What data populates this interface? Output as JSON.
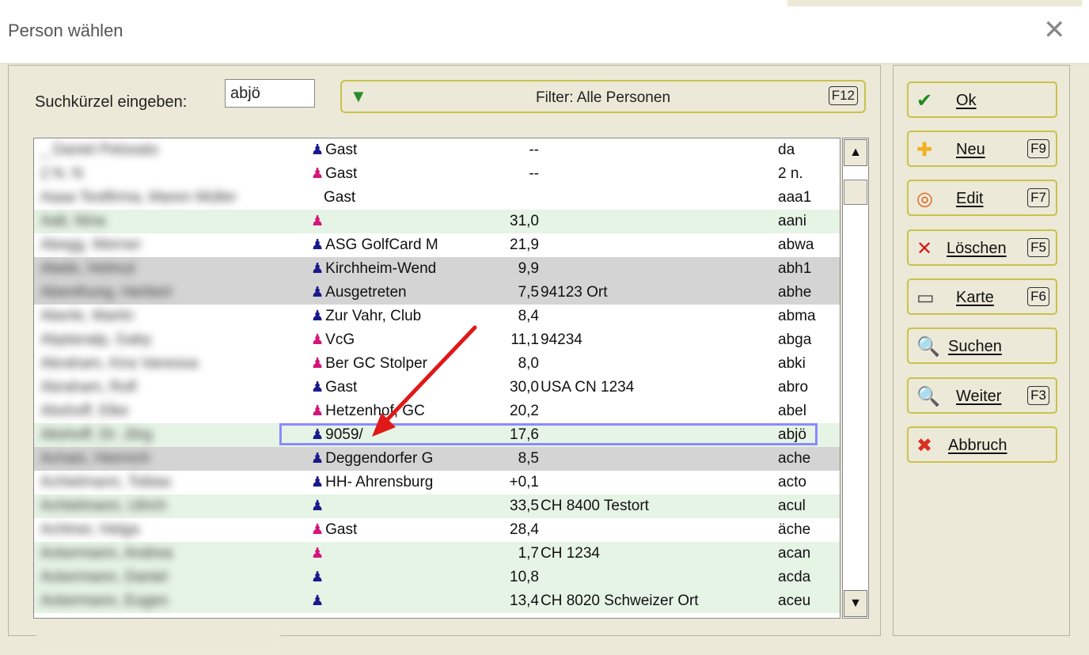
{
  "window": {
    "title": "Person wählen",
    "close_glyph": "✕"
  },
  "search": {
    "label": "Suchkürzel eingeben:",
    "value": "abjö"
  },
  "filter": {
    "label": "Filter: Alle Personen",
    "key": "F12",
    "icon": "filter-funnel-icon"
  },
  "colors": {
    "male": "#1a1a8c",
    "female": "#d6157a",
    "highlight": "#e6f4e6",
    "gray": "#d4d4d4",
    "selected_border": "#8a8aff",
    "button_border": "#c9c24a"
  },
  "rows": [
    {
      "blur": "_ Daniel Pelosato",
      "gender": "m",
      "club": "Gast",
      "hcp": "--",
      "place": "",
      "code": "da",
      "bg": "white"
    },
    {
      "blur": "2 N. N",
      "gender": "f",
      "club": "Gast",
      "hcp": "--",
      "place": "",
      "code": "2 n.",
      "bg": "white"
    },
    {
      "blur": "Aaaa Testfirma, Maren Müller",
      "gender": "",
      "club": "Gast",
      "hcp": "",
      "place": "",
      "code": "aaa1",
      "bg": "white"
    },
    {
      "blur": "Aalt, Nina",
      "gender": "f",
      "club": "",
      "hcp": "31,0",
      "place": "",
      "code": "aani",
      "bg": "green"
    },
    {
      "blur": "Abegg, Werner",
      "gender": "m",
      "club": "ASG GolfCard M",
      "hcp": "21,9",
      "place": "",
      "code": "abwa",
      "bg": "white"
    },
    {
      "blur": "Abele, Helmut",
      "gender": "m",
      "club": "Kirchheim-Wend",
      "hcp": "9,9",
      "place": "",
      "code": "abh1",
      "bg": "gray"
    },
    {
      "blur": "Abenthung, Herbert",
      "gender": "m",
      "club": "Ausgetreten",
      "hcp": "7,5",
      "place": "94123 Ort",
      "code": "abhe",
      "bg": "gray"
    },
    {
      "blur": "Aberle, Martin",
      "gender": "m",
      "club": "Zur Vahr, Club",
      "hcp": "8,4",
      "place": "",
      "code": "abma",
      "bg": "white"
    },
    {
      "blur": "Abplanalp, Gaby",
      "gender": "f",
      "club": "VcG",
      "hcp": "11,1",
      "place": "94234",
      "code": "abga",
      "bg": "white"
    },
    {
      "blur": "Abraham, Kira Vanessa",
      "gender": "f",
      "club": "Ber GC Stolper",
      "hcp": "8,0",
      "place": "",
      "code": "abki",
      "bg": "white"
    },
    {
      "blur": "Abraham, Rolf",
      "gender": "m",
      "club": "Gast",
      "hcp": "30,0",
      "place": "USA CN 1234",
      "code": "abro",
      "bg": "white"
    },
    {
      "blur": "Abshoff, Elke",
      "gender": "f",
      "club": "Hetzenhof, GC",
      "hcp": "20,2",
      "place": "",
      "code": "abel",
      "bg": "white"
    },
    {
      "blur": "Abshoff, Dr. Jörg",
      "gender": "m",
      "club": "9059/",
      "hcp": "17,6",
      "place": "",
      "code": "abjö",
      "bg": "green",
      "selected": true
    },
    {
      "blur": "Achatz, Heinrich",
      "gender": "m",
      "club": "Deggendorfer G",
      "hcp": "8,5",
      "place": "",
      "code": "ache",
      "bg": "gray"
    },
    {
      "blur": "Achtelmann, Tobias",
      "gender": "m",
      "club": "HH- Ahrensburg",
      "hcp": "+0,1",
      "place": "",
      "code": "acto",
      "bg": "white"
    },
    {
      "blur": "Achtelmann, Ulrich",
      "gender": "m",
      "club": "",
      "hcp": "33,5",
      "place": "CH 8400 Testort",
      "code": "acul",
      "bg": "green"
    },
    {
      "blur": "Achtner, Helga",
      "gender": "f",
      "club": "Gast",
      "hcp": "28,4",
      "place": "",
      "code": "äche",
      "bg": "white"
    },
    {
      "blur": "Ackermann, Andrea",
      "gender": "f",
      "club": "",
      "hcp": "1,7",
      "place": "CH 1234",
      "code": "acan",
      "bg": "green"
    },
    {
      "blur": "Ackermann, Daniel",
      "gender": "m",
      "club": "",
      "hcp": "10,8",
      "place": "",
      "code": "acda",
      "bg": "green"
    },
    {
      "blur": "Ackermann, Eugen",
      "gender": "m",
      "club": "",
      "hcp": "13,4",
      "place": "CH 8020 Schweizer Ort",
      "code": "aceu",
      "bg": "green"
    }
  ],
  "scrollbar": {
    "up": "▲",
    "down": "▼"
  },
  "buttons": [
    {
      "id": "ok",
      "label": "Ok",
      "key": "",
      "icon": "check-icon",
      "glyph": "✔",
      "color": "#1e8a1e"
    },
    {
      "id": "neu",
      "label": "Neu",
      "key": "F9",
      "icon": "plus-icon",
      "glyph": "✚",
      "color": "#f0b020"
    },
    {
      "id": "edit",
      "label": "Edit",
      "key": "F7",
      "icon": "ring-icon",
      "glyph": "◎",
      "color": "#e0601c"
    },
    {
      "id": "loeschen",
      "label": "Löschen",
      "key": "F5",
      "icon": "delete-x-icon",
      "glyph": "✕",
      "color": "#d81818"
    },
    {
      "id": "karte",
      "label": "Karte",
      "key": "F6",
      "icon": "card-icon",
      "glyph": "▭",
      "color": "#444444"
    },
    {
      "id": "suchen",
      "label": "Suchen",
      "key": "",
      "icon": "magnifier-icon",
      "glyph": "🔍",
      "color": "#3a7bd0"
    },
    {
      "id": "weiter",
      "label": "Weiter",
      "key": "F3",
      "icon": "search-next-icon",
      "glyph": "🔍",
      "color": "#3a7bd0"
    },
    {
      "id": "abbruch",
      "label": "Abbruch",
      "key": "",
      "icon": "cancel-x-icon",
      "glyph": "✖",
      "color": "#d83020"
    }
  ]
}
